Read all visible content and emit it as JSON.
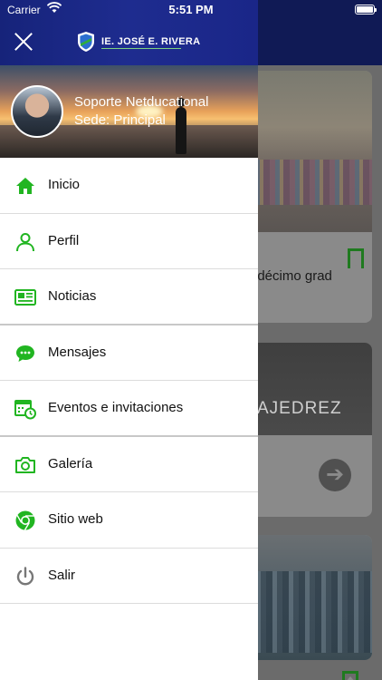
{
  "status_bar": {
    "carrier": "Carrier",
    "time": "5:51 PM"
  },
  "header": {
    "school_name": "IE. JOSÉ E. RIVERA"
  },
  "profile": {
    "name": "Soporte Netducational",
    "sede": "Sede: Principal"
  },
  "menu": {
    "items": [
      {
        "label": "Inicio",
        "icon": "home-icon"
      },
      {
        "label": "Perfil",
        "icon": "person-icon"
      },
      {
        "label": "Noticias",
        "icon": "newspaper-icon"
      },
      {
        "label": "Mensajes",
        "icon": "chat-bubble-icon"
      },
      {
        "label": "Eventos e invitaciones",
        "icon": "calendar-clock-icon"
      },
      {
        "label": "Galería",
        "icon": "camera-icon"
      },
      {
        "label": "Sitio web",
        "icon": "chrome-icon"
      },
      {
        "label": "Salir",
        "icon": "power-icon"
      }
    ]
  },
  "background_feed": {
    "card1_title": "ndécimo grad",
    "card2_image_text": "AJEDREZ"
  },
  "colors": {
    "accent_green": "#21b521",
    "header_blue": "#1a2688"
  }
}
